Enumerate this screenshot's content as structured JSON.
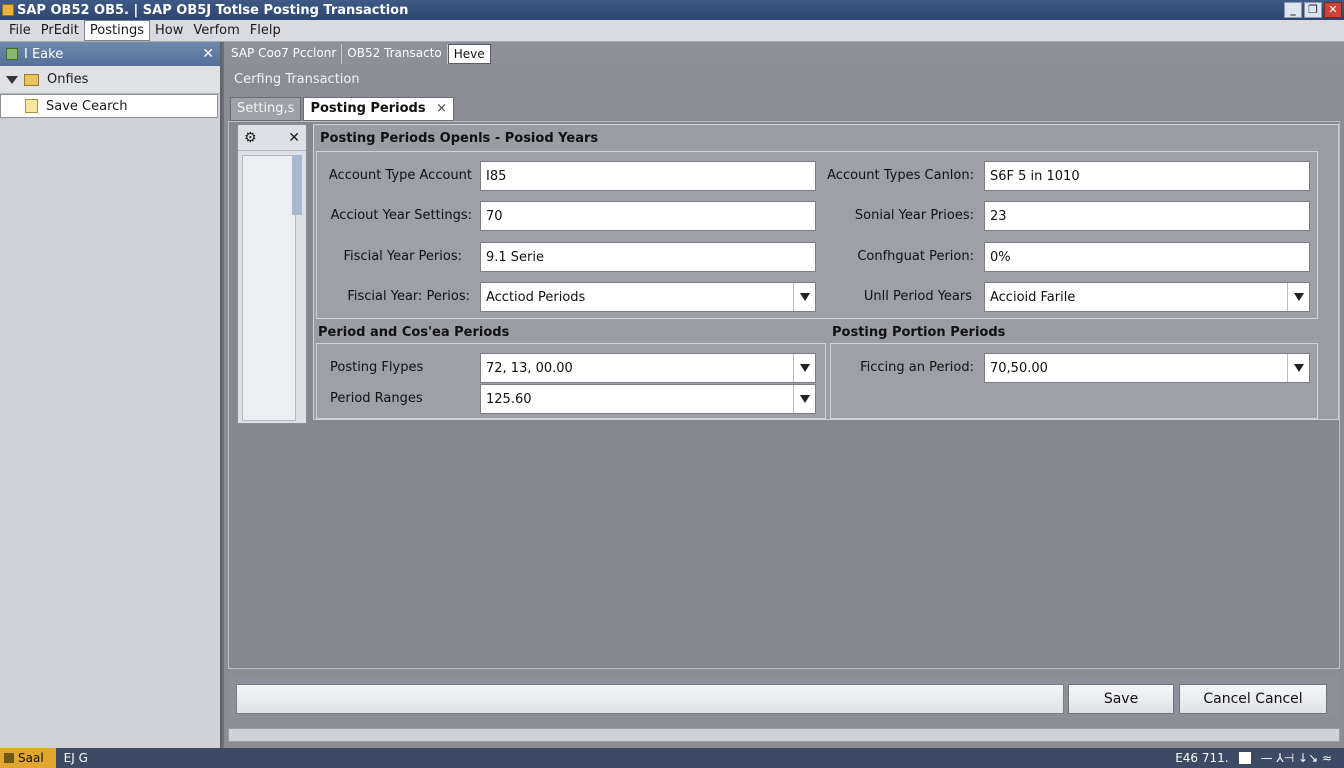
{
  "window": {
    "title": "SAP OB52 OB5. | SAP OB5J Totlse Posting Transaction",
    "buttons": [
      "_",
      "❐",
      "✕"
    ]
  },
  "menu": {
    "items": [
      "File",
      "PrEdit",
      "Postings",
      "How",
      "Verfom",
      "Flelp"
    ],
    "active_index": 2
  },
  "left_pane": {
    "title": "I Eake",
    "close": "✕",
    "tree": [
      {
        "label": "Onfies",
        "type": "folder"
      },
      {
        "label": "Save Cearch",
        "type": "item",
        "selected": true
      }
    ]
  },
  "main_tabs": {
    "items": [
      "SAP Coo7 Pcclonr",
      "OB52 Transacto",
      "Heve"
    ],
    "active_index": 2
  },
  "breadcrumb": "Cerfing Transaction",
  "inner_tabs": {
    "settings": "Setting,s",
    "posting": "Posting Periods",
    "close": "×"
  },
  "side_panel": {
    "gear": "⚙",
    "close": "✕"
  },
  "group": {
    "title": "Posting Periods Openls - Posiod Years",
    "left_fields": [
      {
        "label": "Account Type Account",
        "value": "I85",
        "dropdown": false
      },
      {
        "label": "Acciout Year Settings:",
        "value": "70",
        "dropdown": false
      },
      {
        "label": "Fiscial Year Perios:",
        "value": "9.1 Serie",
        "dropdown": false
      },
      {
        "label": "Fiscial Year: Perios:",
        "value": "Acctiod Periods",
        "dropdown": true
      }
    ],
    "right_fields": [
      {
        "label": "Account Types Canlon:",
        "value": "S6F 5 in 1010",
        "dropdown": false
      },
      {
        "label": "Sonial Year Prioes:",
        "value": "23",
        "dropdown": false
      },
      {
        "label": "Confhguat Perion:",
        "value": "0%",
        "dropdown": false
      },
      {
        "label": "Unll Period Years",
        "value": "Accioid Farile",
        "dropdown": true
      }
    ],
    "period_section": {
      "title": "Period and Cos'ea Periods",
      "fields": [
        {
          "label": "Posting Flypes",
          "value": "72, 13, 00.00"
        },
        {
          "label": "Period Ranges",
          "value": "125.60"
        }
      ]
    },
    "portion_section": {
      "title": "Posting Portion Periods",
      "fields": [
        {
          "label": "Ficcing an Period:",
          "value": "70,50.00"
        }
      ]
    }
  },
  "actions": {
    "save": "Save",
    "cancel": "Cancel Cancel"
  },
  "status": {
    "left": "Saal",
    "code": "EJ G",
    "right": "E46 711.",
    "extra": "— ⅄⊣ ↓↘ ≈"
  }
}
